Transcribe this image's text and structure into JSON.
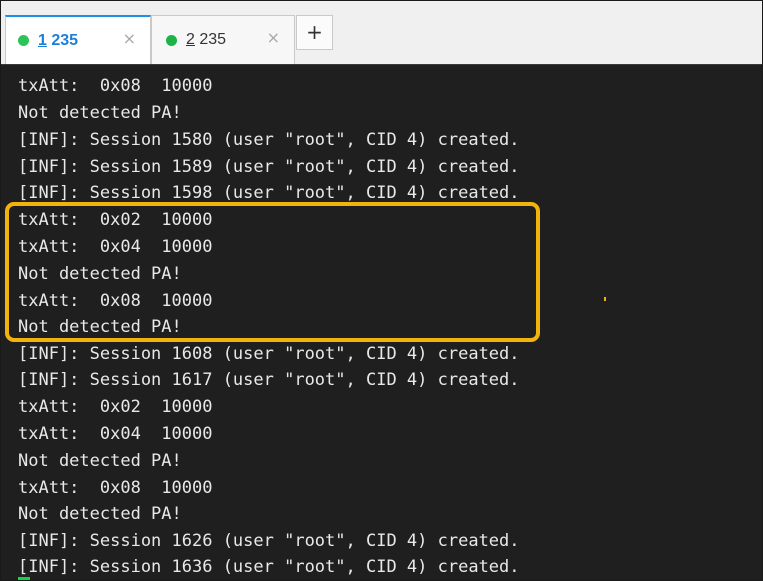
{
  "tabs": [
    {
      "num": "1",
      "title": " 235",
      "close": "×",
      "status_color": "#2ec25a",
      "active": true
    },
    {
      "num": "2",
      "title": " 235",
      "close": "×",
      "status_color": "#1fb246",
      "active": false
    }
  ],
  "add_tab_label": "+",
  "colors": {
    "terminal_bg": "#1f1f1f",
    "text": "#e8e8e8",
    "highlight": "#f2b30d",
    "cursor": "#12d44a",
    "active_tab": "#1e7fd6"
  },
  "terminal_lines": [
    "txAtt:  0x08  10000",
    "Not detected PA!",
    "[INF]: Session 1580 (user \"root\", CID 4) created.",
    "[INF]: Session 1589 (user \"root\", CID 4) created.",
    "[INF]: Session 1598 (user \"root\", CID 4) created.",
    "txAtt:  0x02  10000",
    "txAtt:  0x04  10000",
    "Not detected PA!",
    "txAtt:  0x08  10000",
    "Not detected PA!",
    "[INF]: Session 1608 (user \"root\", CID 4) created.",
    "[INF]: Session 1617 (user \"root\", CID 4) created.",
    "txAtt:  0x02  10000",
    "txAtt:  0x04  10000",
    "Not detected PA!",
    "txAtt:  0x08  10000",
    "Not detected PA!",
    "[INF]: Session 1626 (user \"root\", CID 4) created.",
    "[INF]: Session 1636 (user \"root\", CID 4) created."
  ]
}
